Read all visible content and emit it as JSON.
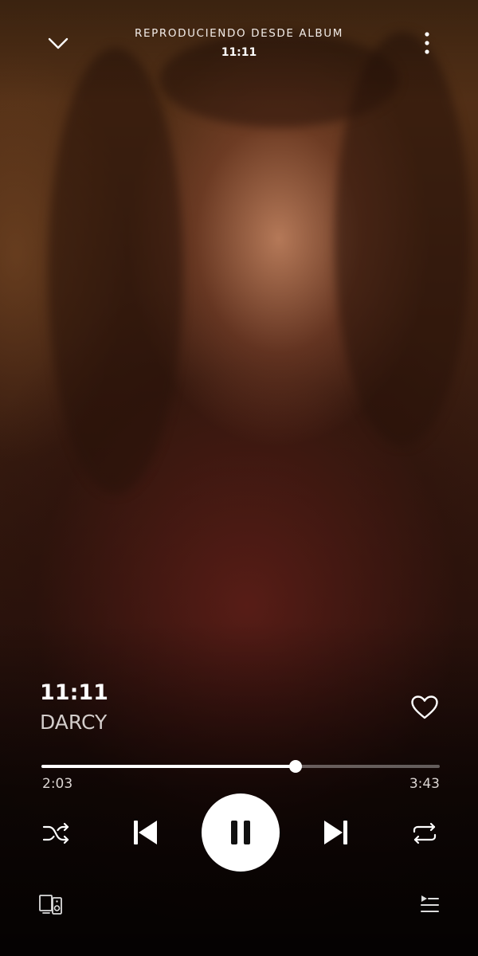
{
  "header": {
    "context_label": "REPRODUCIENDO DESDE ALBUM",
    "album_title": "11:11"
  },
  "track": {
    "title": "11:11",
    "artist": "DARCY",
    "liked": false
  },
  "progress": {
    "elapsed": "2:03",
    "total": "3:43",
    "fraction": 0.637
  },
  "controls": {
    "state": "playing",
    "shuffle": false,
    "repeat": false
  },
  "icons": {
    "collapse": "chevron-down-icon",
    "menu": "more-vertical-icon",
    "like": "heart-outline-icon",
    "shuffle": "shuffle-icon",
    "previous": "skip-previous-icon",
    "play_pause": "pause-icon",
    "next": "skip-next-icon",
    "repeat": "repeat-icon",
    "devices": "devices-icon",
    "queue": "queue-icon"
  },
  "colors": {
    "text": "#ffffff",
    "secondary_text": "#d3cdcb",
    "track_inactive": "rgba(255,255,255,0.35)",
    "play_button_bg": "#ffffff"
  }
}
